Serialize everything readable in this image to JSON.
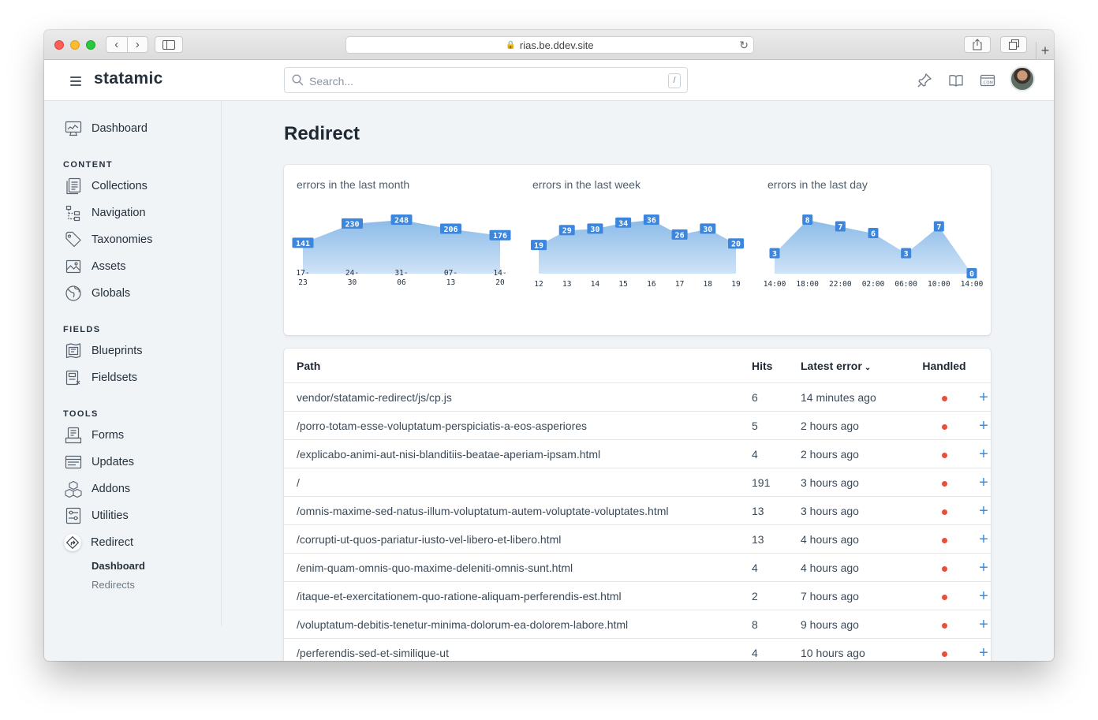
{
  "browser": {
    "url": "rias.be.ddev.site"
  },
  "app": {
    "brand": "statamic",
    "search_placeholder": "Search...",
    "search_shortcut": "/"
  },
  "icons": {
    "header": [
      "pin-icon",
      "book-icon",
      "dotcom-icon"
    ],
    "search": "search-icon"
  },
  "sidebar": {
    "dashboard": "Dashboard",
    "sections": [
      {
        "title": "CONTENT",
        "items": [
          "Collections",
          "Navigation",
          "Taxonomies",
          "Assets",
          "Globals"
        ]
      },
      {
        "title": "FIELDS",
        "items": [
          "Blueprints",
          "Fieldsets"
        ]
      },
      {
        "title": "TOOLS",
        "items": [
          "Forms",
          "Updates",
          "Addons",
          "Utilities",
          "Redirect"
        ]
      }
    ],
    "redirect_sub": [
      "Dashboard",
      "Redirects"
    ]
  },
  "page": {
    "title": "Redirect"
  },
  "charts": {
    "month": {
      "title": "errors in the last month",
      "x": [
        [
          "17-",
          "23"
        ],
        [
          "24-",
          "30"
        ],
        [
          "31-",
          "06"
        ],
        [
          "07-",
          "13"
        ],
        [
          "14-",
          "20"
        ]
      ],
      "values": [
        141,
        230,
        248,
        206,
        176
      ]
    },
    "week": {
      "title": "errors in the last week",
      "x": [
        "12",
        "13",
        "14",
        "15",
        "16",
        "17",
        "18",
        "19"
      ],
      "values": [
        19,
        29,
        30,
        34,
        36,
        26,
        30,
        20
      ]
    },
    "day": {
      "title": "errors in the last day",
      "x": [
        "14:00",
        "18:00",
        "22:00",
        "02:00",
        "06:00",
        "10:00",
        "14:00"
      ],
      "values": [
        3,
        8,
        7,
        6,
        3,
        7,
        0
      ]
    }
  },
  "chart_data": [
    {
      "type": "area",
      "title": "errors in the last month",
      "categories": [
        "17-23",
        "24-30",
        "31-06",
        "07-13",
        "14-20"
      ],
      "values": [
        141,
        230,
        248,
        206,
        176
      ]
    },
    {
      "type": "area",
      "title": "errors in the last week",
      "categories": [
        "12",
        "13",
        "14",
        "15",
        "16",
        "17",
        "18",
        "19"
      ],
      "values": [
        19,
        29,
        30,
        34,
        36,
        26,
        30,
        20
      ]
    },
    {
      "type": "area",
      "title": "errors in the last day",
      "categories": [
        "14:00",
        "18:00",
        "22:00",
        "02:00",
        "06:00",
        "10:00",
        "14:00"
      ],
      "values": [
        3,
        8,
        7,
        6,
        3,
        7,
        0
      ]
    }
  ],
  "table": {
    "headers": {
      "path": "Path",
      "hits": "Hits",
      "latest": "Latest error",
      "handled": "Handled"
    },
    "handled_color": "#e0533a",
    "rows": [
      {
        "path": "vendor/statamic-redirect/js/cp.js",
        "hits": "6",
        "latest": "14 minutes ago"
      },
      {
        "path": "/porro-totam-esse-voluptatum-perspiciatis-a-eos-asperiores",
        "hits": "5",
        "latest": "2 hours ago"
      },
      {
        "path": "/explicabo-animi-aut-nisi-blanditiis-beatae-aperiam-ipsam.html",
        "hits": "4",
        "latest": "2 hours ago"
      },
      {
        "path": "/",
        "hits": "191",
        "latest": "3 hours ago"
      },
      {
        "path": "/omnis-maxime-sed-natus-illum-voluptatum-autem-voluptate-voluptates.html",
        "hits": "13",
        "latest": "3 hours ago"
      },
      {
        "path": "/corrupti-ut-quos-pariatur-iusto-vel-libero-et-libero.html",
        "hits": "13",
        "latest": "4 hours ago"
      },
      {
        "path": "/enim-quam-omnis-quo-maxime-deleniti-omnis-sunt.html",
        "hits": "4",
        "latest": "4 hours ago"
      },
      {
        "path": "/itaque-et-exercitationem-quo-ratione-aliquam-perferendis-est.html",
        "hits": "2",
        "latest": "7 hours ago"
      },
      {
        "path": "/voluptatum-debitis-tenetur-minima-dolorum-ea-dolorem-labore.html",
        "hits": "8",
        "latest": "9 hours ago"
      },
      {
        "path": "/perferendis-sed-et-similique-ut",
        "hits": "4",
        "latest": "10 hours ago"
      }
    ]
  }
}
